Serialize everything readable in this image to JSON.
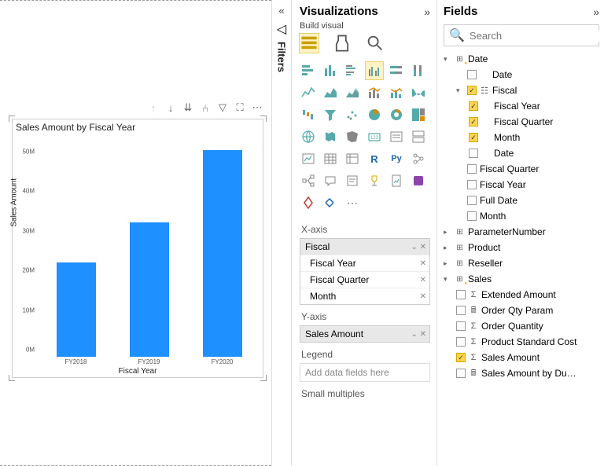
{
  "chart_data": {
    "type": "bar",
    "title": "Sales Amount by Fiscal Year",
    "categories": [
      "FY2018",
      "FY2019",
      "FY2020"
    ],
    "values": [
      24000000,
      34000000,
      52000000
    ],
    "xlabel": "Fiscal Year",
    "ylabel": "Sales Amount",
    "ylim": [
      0,
      55000000
    ],
    "yticks": [
      "0M",
      "10M",
      "20M",
      "30M",
      "40M",
      "50M"
    ]
  },
  "filters_label": "Filters",
  "viz": {
    "title": "Visualizations",
    "subhead": "Build visual",
    "wells": {
      "xaxis": {
        "label": "X-axis",
        "group": "Fiscal",
        "items": [
          "Fiscal Year",
          "Fiscal Quarter",
          "Month"
        ]
      },
      "yaxis": {
        "label": "Y-axis",
        "items": [
          "Sales Amount"
        ]
      },
      "legend": {
        "label": "Legend",
        "placeholder": "Add data fields here"
      },
      "small": {
        "label": "Small multiples"
      }
    }
  },
  "fields": {
    "title": "Fields",
    "search_placeholder": "Search",
    "tables": {
      "date": {
        "label": "Date",
        "items": [
          {
            "label": "Date",
            "checked": false
          },
          {
            "label": "Fiscal",
            "group": true,
            "checked": true,
            "children": [
              {
                "label": "Fiscal Year",
                "checked": true
              },
              {
                "label": "Fiscal Quarter",
                "checked": true
              },
              {
                "label": "Month",
                "checked": true
              },
              {
                "label": "Date",
                "checked": false
              }
            ]
          },
          {
            "label": "Fiscal Quarter",
            "checked": false
          },
          {
            "label": "Fiscal Year",
            "checked": false
          },
          {
            "label": "Full Date",
            "checked": false
          },
          {
            "label": "Month",
            "checked": false
          }
        ]
      },
      "param": {
        "label": "ParameterNumber"
      },
      "product": {
        "label": "Product"
      },
      "reseller": {
        "label": "Reseller"
      },
      "sales": {
        "label": "Sales",
        "items": [
          {
            "label": "Extended Amount",
            "icon": "Σ"
          },
          {
            "label": "Order Qty Param",
            "icon": "calc"
          },
          {
            "label": "Order Quantity",
            "icon": "Σ"
          },
          {
            "label": "Product Standard Cost",
            "icon": "Σ"
          },
          {
            "label": "Sales Amount",
            "icon": "Σ",
            "checked": true
          },
          {
            "label": "Sales Amount by Du…",
            "icon": "calc"
          }
        ]
      }
    }
  }
}
